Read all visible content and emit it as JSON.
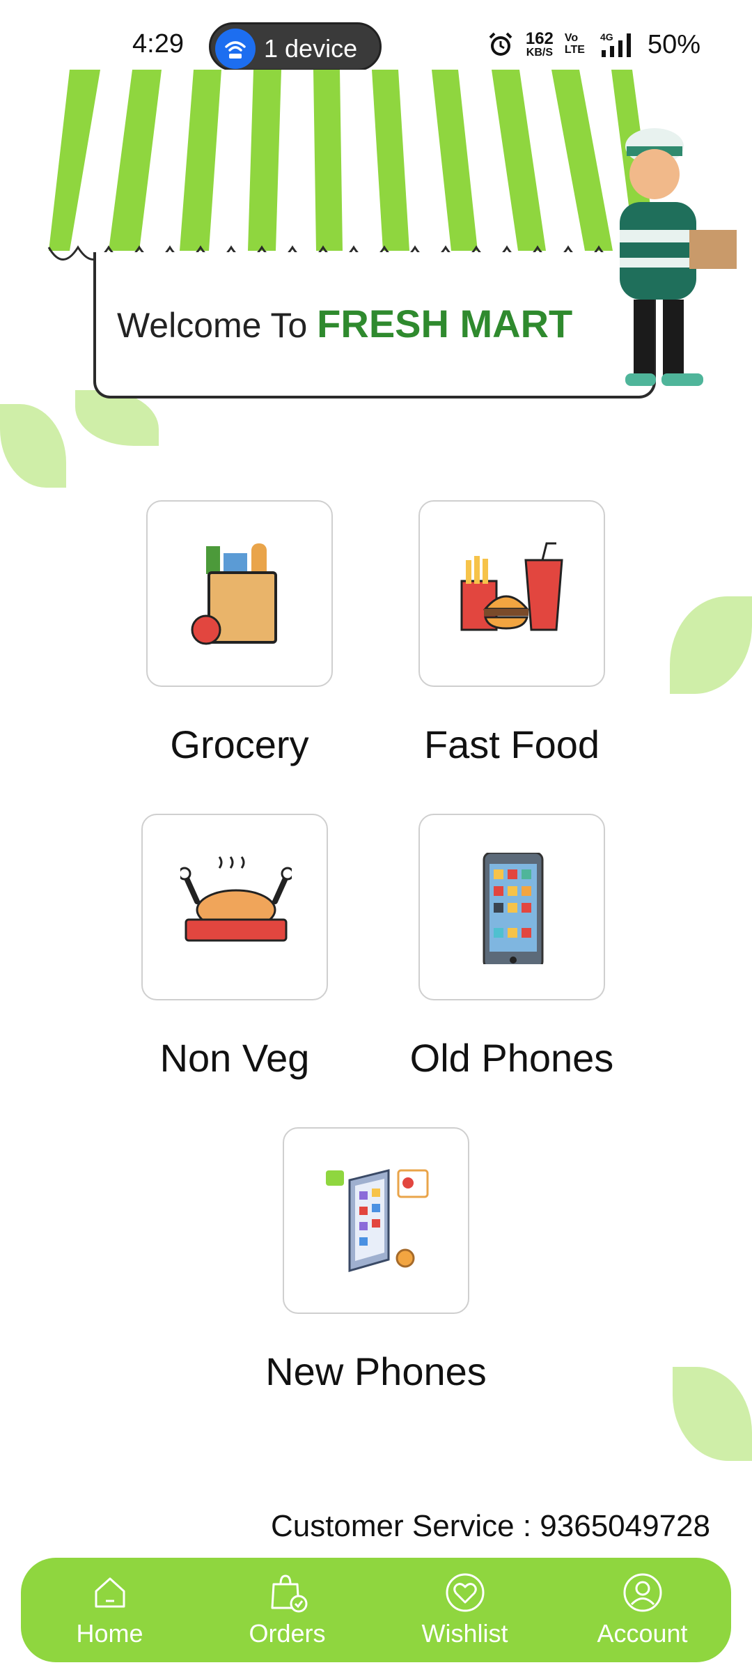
{
  "status_bar": {
    "time": "4:29",
    "hotspot": "1 device",
    "speed_value": "162",
    "speed_unit": "KB/S",
    "volte_top": "Vo",
    "volte_bottom": "LTE",
    "network": "4G",
    "battery": "50%"
  },
  "banner": {
    "welcome_prefix": "Welcome To ",
    "brand": "FRESH MART",
    "accent_color": "#8fd63f",
    "brand_color": "#2f8a2e"
  },
  "categories": [
    {
      "label": "Grocery",
      "icon": "grocery-bag-icon"
    },
    {
      "label": "Fast Food",
      "icon": "fast-food-icon"
    },
    {
      "label": "Non Veg",
      "icon": "roast-chicken-icon"
    },
    {
      "label": "Old Phones",
      "icon": "old-phone-icon"
    },
    {
      "label": "New Phones",
      "icon": "new-phone-icon"
    }
  ],
  "customer_service": "Customer Service : 9365049728",
  "bottom_nav": [
    {
      "label": "Home",
      "icon": "home-icon"
    },
    {
      "label": "Orders",
      "icon": "orders-bag-icon"
    },
    {
      "label": "Wishlist",
      "icon": "heart-icon"
    },
    {
      "label": "Account",
      "icon": "account-icon"
    }
  ]
}
